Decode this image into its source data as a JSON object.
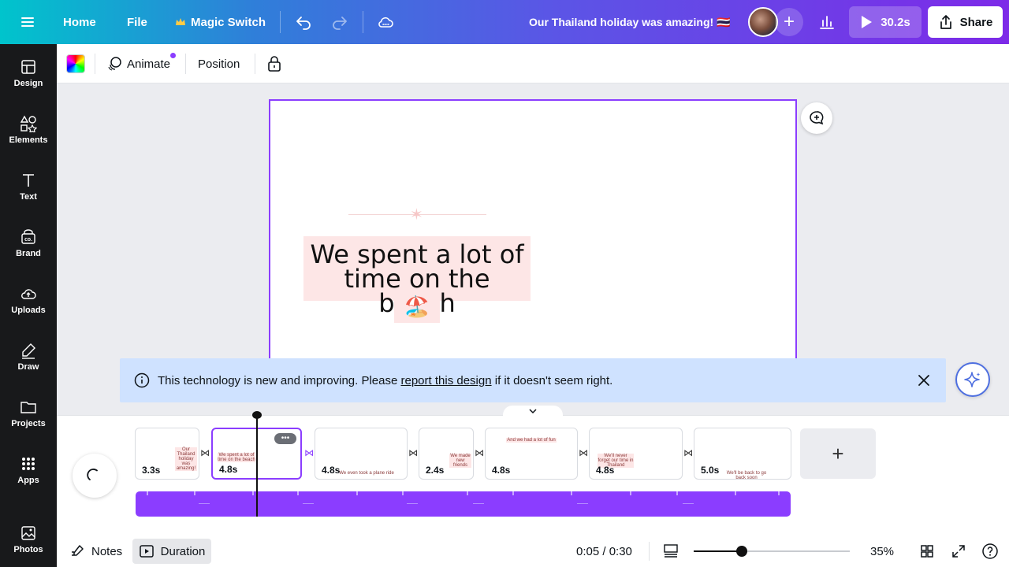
{
  "topbar": {
    "home": "Home",
    "file": "File",
    "magic_switch": "Magic Switch",
    "title": "Our Thailand holiday was amazing! 🇹🇭",
    "play_duration": "30.2s",
    "share": "Share"
  },
  "sidebar": {
    "items": [
      {
        "label": "Design",
        "icon": "design-icon"
      },
      {
        "label": "Elements",
        "icon": "elements-icon"
      },
      {
        "label": "Text",
        "icon": "text-icon"
      },
      {
        "label": "Brand",
        "icon": "brand-icon"
      },
      {
        "label": "Uploads",
        "icon": "upload-cloud-icon"
      },
      {
        "label": "Draw",
        "icon": "draw-pen-icon"
      },
      {
        "label": "Projects",
        "icon": "folder-icon"
      },
      {
        "label": "Apps",
        "icon": "apps-grid-icon"
      },
      {
        "label": "Photos",
        "icon": "photo-icon"
      }
    ]
  },
  "context_toolbar": {
    "animate": "Animate",
    "position": "Position"
  },
  "canvas": {
    "headline_line1": "We spent a lot of",
    "headline_line2": "time on the beach",
    "emoji": "🏖️"
  },
  "banner": {
    "text_before": "This technology is new and improving. Please ",
    "link": "report this design",
    "text_after": " if it doesn't seem right."
  },
  "timeline": {
    "clips": [
      {
        "duration": "3.3s",
        "preview": "Our Thailand holiday was amazing!"
      },
      {
        "duration": "4.8s",
        "preview": "We spent a lot of time on the beach"
      },
      {
        "duration": "4.8s",
        "preview": "We even took a plane ride"
      },
      {
        "duration": "2.4s",
        "preview": "We made new friends"
      },
      {
        "duration": "4.8s",
        "preview": "And we had a lot of fun"
      },
      {
        "duration": "4.8s",
        "preview": "We'll never forget our time in Thailand"
      },
      {
        "duration": "5.0s",
        "preview": "We'll be back to go back soon"
      }
    ],
    "more": "•••"
  },
  "bottombar": {
    "notes": "Notes",
    "duration": "Duration",
    "time": "0:05 / 0:30",
    "zoom": "35%",
    "zoom_level": 0.31
  },
  "colors": {
    "accent": "#8b3dff",
    "banner": "#cfe2ff",
    "sidebar": "#18191b"
  }
}
